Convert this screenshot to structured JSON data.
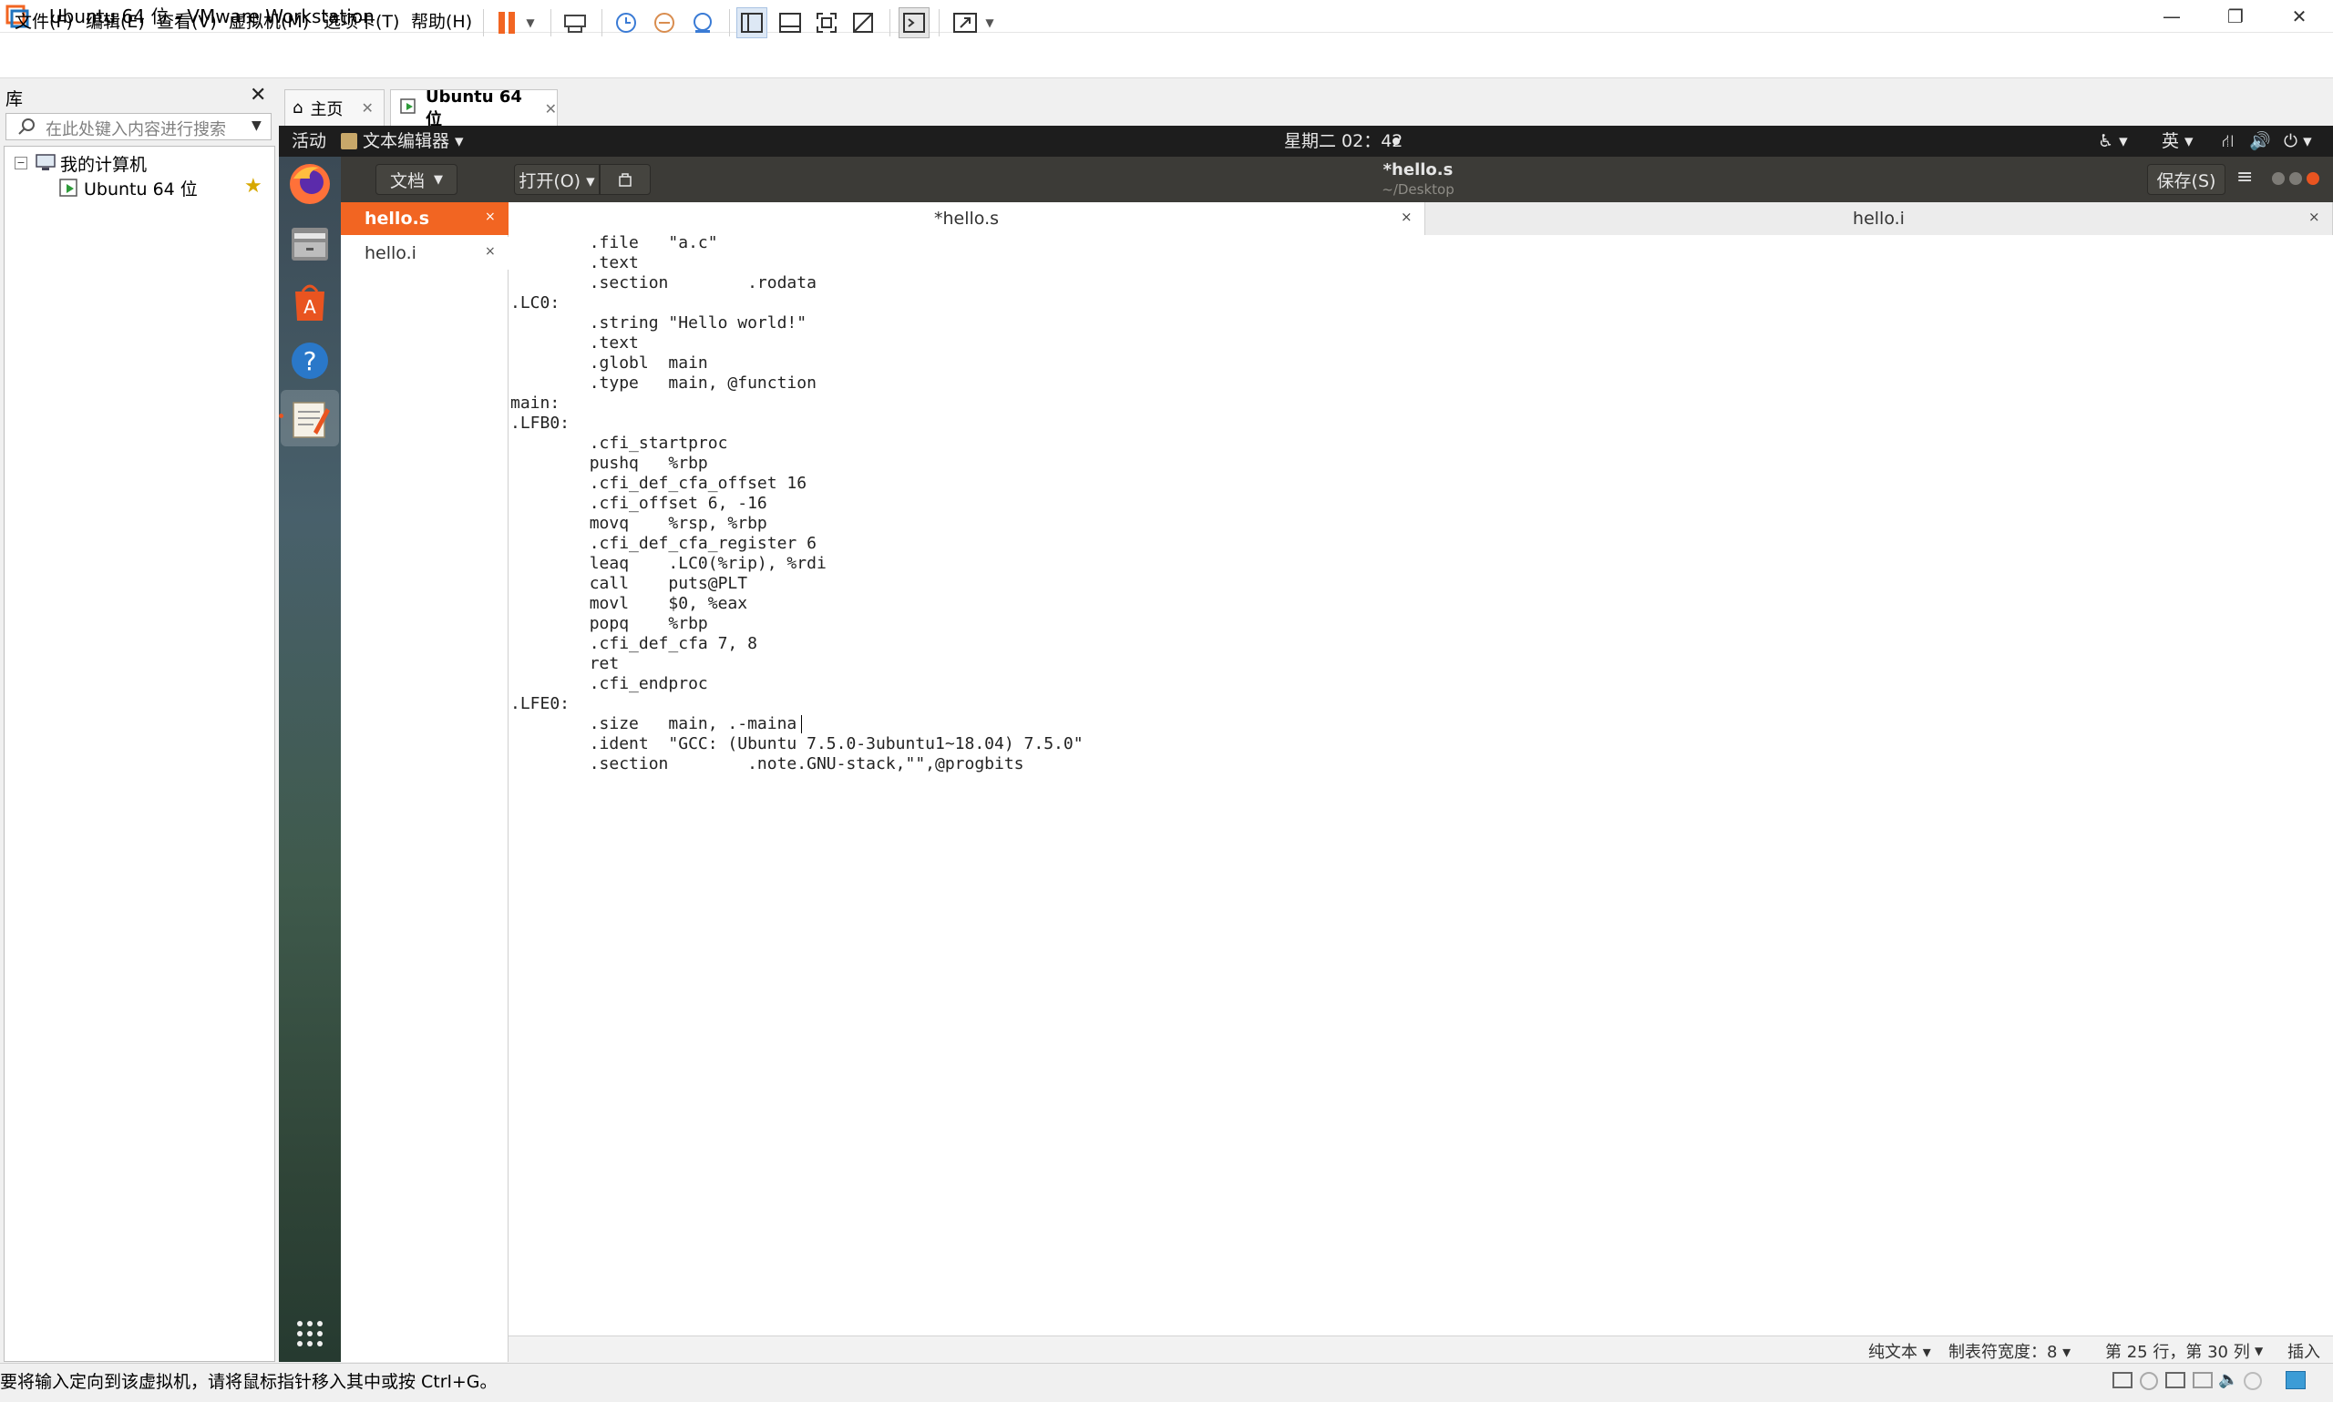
{
  "window": {
    "title": "Ubuntu 64 位 - VMware Workstation"
  },
  "menu": [
    "文件(F)",
    "编辑(E)",
    "查看(V)",
    "虚拟机(M)",
    "选项卡(T)",
    "帮助(H)"
  ],
  "library": {
    "title": "库",
    "search_placeholder": "在此处键入内容进行搜索",
    "tree": {
      "root": "我的计算机",
      "child": "Ubuntu 64 位"
    }
  },
  "tabs": {
    "home": "主页",
    "vm": "Ubuntu 64 位"
  },
  "gnome": {
    "activities": "活动",
    "app_menu": "文本编辑器 ▾",
    "clock": "星期二 02：42",
    "lang": "英 ▾"
  },
  "gedit": {
    "docs_btn": "文档",
    "open_btn": "打开(O) ▾",
    "title": "*hello.s",
    "subtitle": "~/Desktop",
    "save_btn": "保存(S)",
    "sidebar_items": [
      "hello.s",
      "hello.i"
    ],
    "tabs": [
      "*hello.s",
      "hello.i"
    ],
    "code": "        .file   \"a.c\"\n        .text\n        .section        .rodata\n.LC0:\n        .string \"Hello world!\"\n        .text\n        .globl  main\n        .type   main, @function\nmain:\n.LFB0:\n        .cfi_startproc\n        pushq   %rbp\n        .cfi_def_cfa_offset 16\n        .cfi_offset 6, -16\n        movq    %rsp, %rbp\n        .cfi_def_cfa_register 6\n        leaq    .LC0(%rip), %rdi\n        call    puts@PLT\n        movl    $0, %eax\n        popq    %rbp\n        .cfi_def_cfa 7, 8\n        ret\n        .cfi_endproc\n.LFE0:\n        .size   main, .-maina\n        .ident  \"GCC: (Ubuntu 7.5.0-3ubuntu1~18.04) 7.5.0\"\n        .section        .note.GNU-stack,\"\",@progbits",
    "status": {
      "syntax": "纯文本 ▾",
      "tab_width": "制表符宽度：8 ▾",
      "position": "第 25 行，第 30 列",
      "mode": "插入"
    }
  },
  "host_status": "要将输入定向到该虚拟机，请将鼠标指针移入其中或按 Ctrl+G。",
  "colors": {
    "accent_orange": "#e95420",
    "vmware_orange": "#f26522"
  }
}
